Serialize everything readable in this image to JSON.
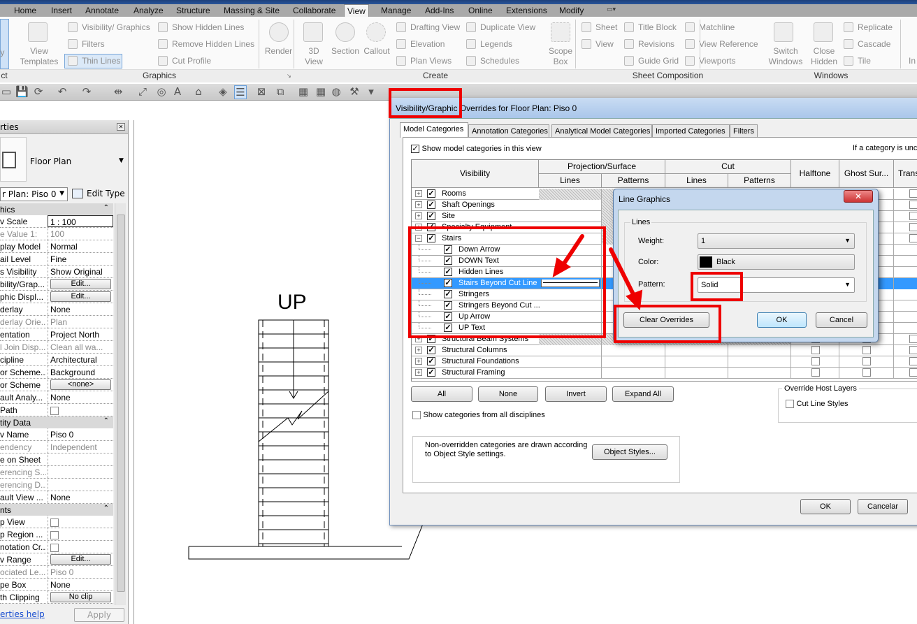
{
  "ribbon": {
    "tabs": [
      "Home",
      "Insert",
      "Annotate",
      "Analyze",
      "Structure",
      "Massing & Site",
      "Collaborate",
      "View",
      "Manage",
      "Add-Ins",
      "Online",
      "Extensions",
      "Modify"
    ],
    "active_tab": "View",
    "modify_partial": "fy",
    "graphics": {
      "view_templates": "View\nTemplates",
      "visibility_graphics": "Visibility/ Graphics",
      "filters": "Filters",
      "thin_lines": "Thin Lines",
      "show_hidden_lines": "Show Hidden Lines",
      "remove_hidden_lines": "Remove Hidden Lines",
      "cut_profile": "Cut Profile"
    },
    "render": "Render",
    "create": {
      "view_3d": "3D\nView",
      "section": "Section",
      "callout": "Callout",
      "drafting_view": "Drafting View",
      "elevation": "Elevation",
      "plan_views": "Plan Views",
      "duplicate_view": "Duplicate View",
      "legends": "Legends",
      "schedules": "Schedules",
      "scope_box": "Scope\nBox"
    },
    "sheet": {
      "sheet": "Sheet",
      "view": "View",
      "title_block": "Title Block",
      "revisions": "Revisions",
      "guide_grid": "Guide Grid",
      "matchline": "Matchline",
      "view_reference": "View Reference",
      "viewports": "Viewports"
    },
    "windows": {
      "switch_windows": "Switch\nWindows",
      "close_hidden": "Close\nHidden",
      "replicate": "Replicate",
      "cascade": "Cascade",
      "tile": "Tile",
      "partial": "In"
    },
    "panels": {
      "select_partial": "ct",
      "graphics": "Graphics",
      "create": "Create",
      "sheet_composition": "Sheet Composition",
      "windows": "Windows"
    }
  },
  "qat_icons": [
    "open-icon",
    "save-icon",
    "sync-icon",
    "undo-icon",
    "redo-icon",
    "measure-icon",
    "dimension-icon",
    "tag-icon",
    "text-icon",
    "3d-view-icon",
    "section-icon",
    "thin-lines-icon",
    "close-hidden-icon",
    "switch-windows-icon",
    "grid-icon",
    "grid2-icon",
    "render-icon",
    "settings-icon",
    "dropdown-icon"
  ],
  "properties": {
    "title": "rties",
    "type_name": "Floor Plan",
    "instance": "r Plan: Piso 0",
    "edit_type": "Edit Type",
    "help": "erties help",
    "apply": "Apply",
    "rows": [
      {
        "kind": "sec",
        "label": "hics"
      },
      {
        "label": "v Scale",
        "value": "1 : 100",
        "type": "input"
      },
      {
        "label": "e Value    1:",
        "value": "100",
        "grey": true
      },
      {
        "label": "play Model",
        "value": "Normal"
      },
      {
        "label": "ail Level",
        "value": "Fine"
      },
      {
        "label": "s Visibility",
        "value": "Show Original"
      },
      {
        "label": "bility/Grap...",
        "value": "Edit...",
        "type": "button"
      },
      {
        "label": "phic Displ...",
        "value": "Edit...",
        "type": "button"
      },
      {
        "label": "derlay",
        "value": "None"
      },
      {
        "label": "derlay Orie...",
        "value": "Plan",
        "grey": true
      },
      {
        "label": "entation",
        "value": "Project North"
      },
      {
        "label": "l Join Disp...",
        "value": "Clean all wa...",
        "grey": true
      },
      {
        "label": "cipline",
        "value": "Architectural"
      },
      {
        "label": "or Scheme...",
        "value": "Background"
      },
      {
        "label": "or Scheme",
        "value": "<none>",
        "type": "button"
      },
      {
        "label": "ault Analy...",
        "value": "None"
      },
      {
        "label": " Path",
        "value": "",
        "type": "checkbox"
      },
      {
        "kind": "sec",
        "label": "tity Data"
      },
      {
        "label": "v Name",
        "value": "Piso 0"
      },
      {
        "label": "endency",
        "value": "Independent",
        "grey": true
      },
      {
        "label": "e on Sheet",
        "value": ""
      },
      {
        "label": "erencing S...",
        "value": "",
        "grey": true
      },
      {
        "label": "erencing D...",
        "value": "",
        "grey": true
      },
      {
        "label": "ault View ...",
        "value": "None"
      },
      {
        "kind": "sec",
        "label": "nts"
      },
      {
        "label": "p View",
        "value": "",
        "type": "checkbox"
      },
      {
        "label": "p Region ...",
        "value": "",
        "type": "checkbox"
      },
      {
        "label": "notation Cr...",
        "value": "",
        "type": "checkbox"
      },
      {
        "label": "v Range",
        "value": "Edit...",
        "type": "button"
      },
      {
        "label": "ociated Le...",
        "value": "Piso 0",
        "grey": true
      },
      {
        "label": "pe Box",
        "value": "None"
      },
      {
        "label": "th Clipping",
        "value": "No clip",
        "type": "button"
      }
    ]
  },
  "canvas": {
    "up_label": "UP"
  },
  "vg_dialog": {
    "title": "Visibility/Graphic Overrides for Floor Plan: Piso 0",
    "tabs": [
      "Model Categories",
      "Annotation Categories",
      "Analytical Model Categories",
      "Imported Categories",
      "Filters"
    ],
    "show_model": "Show model categories in this view",
    "hint": "If a category is unc",
    "headers": {
      "visibility": "Visibility",
      "projection": "Projection/Surface",
      "cut": "Cut",
      "lines": "Lines",
      "patterns": "Patterns",
      "halftone": "Halftone",
      "ghost": "Ghost Sur...",
      "trans": "Trans"
    },
    "rows": [
      {
        "name": "Rooms",
        "level": 0,
        "expand": "+"
      },
      {
        "name": "Shaft Openings",
        "level": 0,
        "expand": "+"
      },
      {
        "name": "Site",
        "level": 0,
        "expand": "+"
      },
      {
        "name": "Specialty Equipment",
        "level": 0,
        "expand": "+"
      },
      {
        "name": "Stairs",
        "level": 0,
        "expand": "-"
      },
      {
        "name": "Down Arrow",
        "level": 1
      },
      {
        "name": "DOWN Text",
        "level": 1
      },
      {
        "name": "Hidden Lines",
        "level": 1
      },
      {
        "name": "Stairs Beyond Cut Line",
        "level": 1,
        "selected": true
      },
      {
        "name": "Stringers",
        "level": 1
      },
      {
        "name": "Stringers Beyond Cut ...",
        "level": 1
      },
      {
        "name": "Up Arrow",
        "level": 1
      },
      {
        "name": "UP Text",
        "level": 1
      },
      {
        "name": "Structural Beam Systems",
        "level": 0,
        "expand": "+"
      },
      {
        "name": "Structural Columns",
        "level": 0,
        "expand": "+"
      },
      {
        "name": "Structural Foundations",
        "level": 0,
        "expand": "+"
      },
      {
        "name": "Structural Framing",
        "level": 0,
        "expand": "+"
      }
    ],
    "buttons": {
      "all": "All",
      "none": "None",
      "invert": "Invert",
      "expand_all": "Expand All"
    },
    "show_all_disciplines": "Show categories from all disciplines",
    "override_host": "Override Host Layers",
    "cut_line_styles": "Cut Line Styles",
    "note": "Non-overridden categories are drawn according to Object Style settings.",
    "object_styles": "Object Styles...",
    "ok": "OK",
    "cancel": "Cancelar"
  },
  "line_graphics": {
    "title": "Line Graphics",
    "group": "Lines",
    "weight_label": "Weight:",
    "weight": "1",
    "color_label": "Color:",
    "color": "Black",
    "color_hex": "#000000",
    "pattern_label": "Pattern:",
    "pattern": "Solid",
    "clear": "Clear Overrides",
    "ok": "OK",
    "cancel": "Cancel"
  },
  "colors": {
    "accent_red": "#e00000",
    "selection": "#3399ff"
  }
}
